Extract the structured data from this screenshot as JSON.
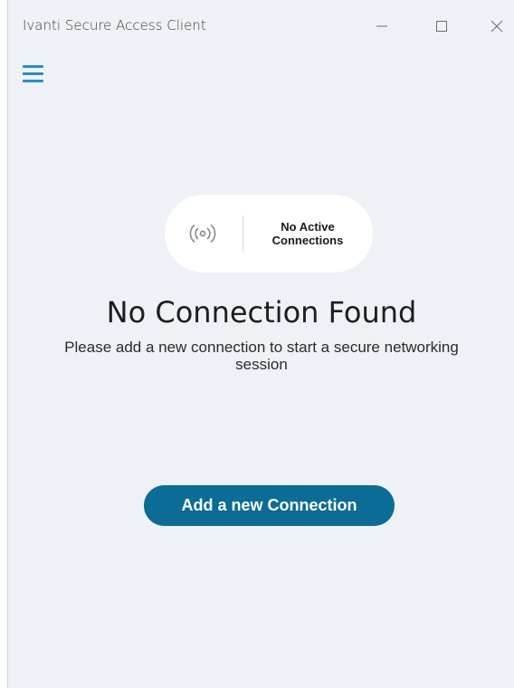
{
  "window": {
    "title": "Ivanti Secure Access Client",
    "controls": [
      "minimize",
      "maximize",
      "close"
    ]
  },
  "menu": {
    "icon": "hamburger-menu-icon"
  },
  "status": {
    "icon": "signal-broadcast-icon",
    "line1": "No Active",
    "line2": "Connections"
  },
  "main": {
    "heading": "No Connection Found",
    "description": "Please add a new connection to start a secure networking session",
    "add_button_label": "Add a new Connection"
  },
  "colors": {
    "background": "#eef1f5",
    "accent": "#0b6c95",
    "menu_icon": "#2b8cc4"
  }
}
